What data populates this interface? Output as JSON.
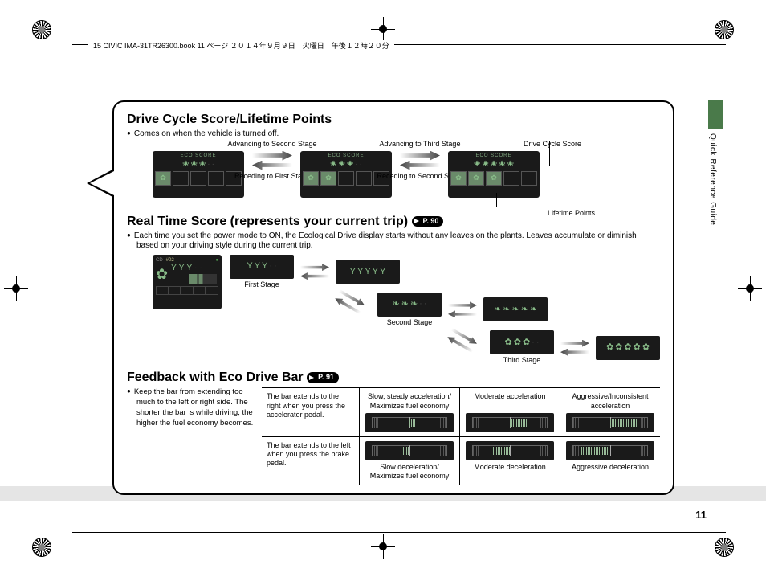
{
  "header": "15 CIVIC IMA-31TR26300.book  11 ページ  ２０１４年９月９日　火曜日　午後１２時２０分",
  "page_number": "11",
  "side_tab": "Quick Reference Guide",
  "section1": {
    "title": "Drive Cycle Score/Lifetime Points",
    "bullet": "Comes on when the vehicle is turned off.",
    "adv2": "Advancing to Second Stage",
    "rec1": "Receding to First Stage",
    "adv3": "Advancing to Third Stage",
    "rec2": "Receding to Second Stage",
    "callout_top": "Drive Cycle Score",
    "callout_bot": "Lifetime Points",
    "eco_score": "ECO SCORE"
  },
  "section2": {
    "title": "Real Time Score (represents your current trip)",
    "pref": "P. 90",
    "bullet": "Each time you set the power mode to ON, the Ecological Drive display starts without any leaves on the plants. Leaves accumulate or diminish based on your driving style during the current trip.",
    "stage1": "First Stage",
    "stage2": "Second Stage",
    "stage3": "Third Stage",
    "cd": "CD",
    "track": "#02"
  },
  "section3": {
    "title": "Feedback with Eco Drive Bar",
    "pref": "P. 91",
    "intro": "Keep the bar from extending too much to the left or right side. The shorter the bar is while driving, the higher the fuel economy becomes.",
    "row1_desc": "The bar extends to the right when you press the accelerator pedal.",
    "row2_desc": "The bar extends to the left when you press the brake pedal.",
    "r1c1": "Slow, steady acceleration/ Maximizes fuel economy",
    "r1c2": "Moderate acceleration",
    "r1c3": "Aggressive/Inconsistent acceleration",
    "r2c1": "Slow deceleration/ Maximizes fuel economy",
    "r2c2": "Moderate deceleration",
    "r2c3": "Aggressive deceleration"
  }
}
